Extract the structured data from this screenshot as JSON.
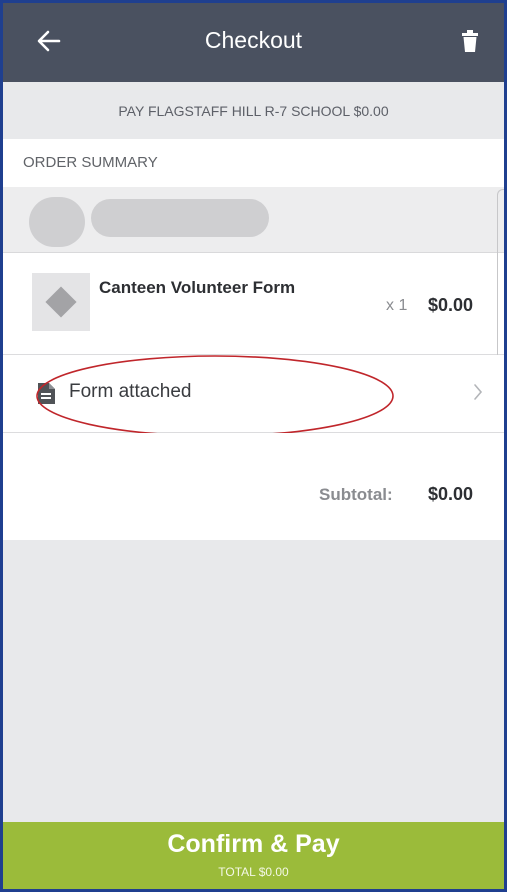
{
  "appbar": {
    "title": "Checkout"
  },
  "banner": {
    "text": "PAY FLAGSTAFF HILL R-7 SCHOOL $0.00"
  },
  "summary": {
    "label": "ORDER SUMMARY"
  },
  "item": {
    "name": "Canteen Volunteer Form",
    "qty": "x 1",
    "price": "$0.00"
  },
  "form": {
    "label": "Form attached"
  },
  "subtotal": {
    "label": "Subtotal:",
    "value": "$0.00"
  },
  "confirm": {
    "label": "Confirm & Pay",
    "total": "TOTAL $0.00"
  },
  "colors": {
    "appbar": "#4a5160",
    "confirm": "#9bbb3a",
    "annotation": "#c0262b",
    "frame": "#1f3f8f"
  },
  "icons": [
    "arrow-left-icon",
    "trash-icon",
    "diamond-placeholder-icon",
    "document-icon",
    "chevron-right-icon"
  ]
}
